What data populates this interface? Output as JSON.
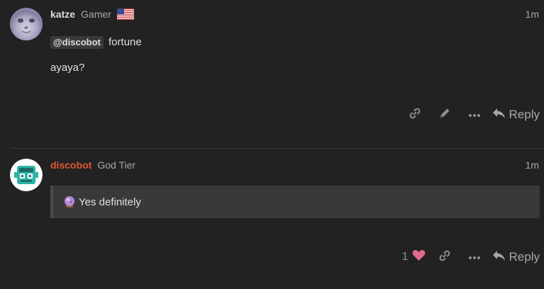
{
  "posts": [
    {
      "username": "katze",
      "user_title": "Gamer",
      "flag_icon": "us-flag-icon",
      "date": "1m",
      "mention": "@discobot",
      "mention_suffix": "fortune",
      "body_line2": "ayaya?",
      "actions": {
        "link_icon": "link-icon",
        "edit_icon": "pencil-icon",
        "more_icon": "ellipsis-icon",
        "reply_label": "Reply"
      }
    },
    {
      "username": "discobot",
      "user_title": "God Tier",
      "date": "1m",
      "quote_text": "Yes definitely",
      "quote_icon": "crystal-ball-icon",
      "actions": {
        "like_count": "1",
        "like_icon": "heart-icon",
        "link_icon": "link-icon",
        "more_icon": "ellipsis-icon",
        "reply_label": "Reply"
      }
    }
  ],
  "colors": {
    "background": "#222222",
    "staff_name": "#e45735",
    "heart": "#e06a8a",
    "quote_bg": "#393939"
  }
}
